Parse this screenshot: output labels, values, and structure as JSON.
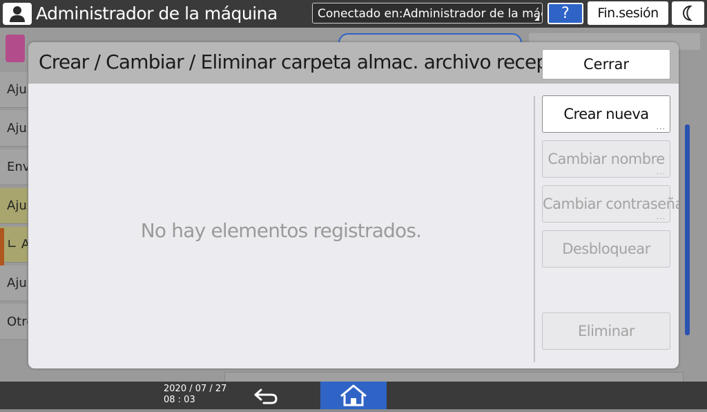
{
  "topbar": {
    "title": "Administrador de la máquina",
    "connection_label": "Conectado en:Administrador de la máquina",
    "help_label": "?",
    "logout_label": "Fin.sesión"
  },
  "sidebar": {
    "items": [
      {
        "label": "Ajus"
      },
      {
        "label": "Ajus"
      },
      {
        "label": "Envi"
      },
      {
        "label": "Ajus"
      },
      {
        "label": "∟ A"
      },
      {
        "label": "Ajus"
      },
      {
        "label": "Otro"
      }
    ]
  },
  "dialog": {
    "title": "Crear / Cambiar / Eliminar carpeta almac. archivo recepción",
    "close_label": "Cerrar",
    "empty_message": "No hay elementos registrados.",
    "actions": [
      {
        "label": "Crear nueva",
        "enabled": true,
        "has_ellipsis": true
      },
      {
        "label": "Cambiar nombre",
        "enabled": false,
        "has_ellipsis": true
      },
      {
        "label": "Cambiar contraseña",
        "enabled": false,
        "has_ellipsis": true
      },
      {
        "label": "Desbloquear",
        "enabled": false,
        "has_ellipsis": false
      },
      {
        "label": "Eliminar",
        "enabled": false,
        "has_ellipsis": false
      }
    ],
    "ellipsis": "..."
  },
  "bottombar": {
    "date": "2020 / 07 / 27",
    "time": "08 : 03"
  },
  "icons": {
    "user": "user-icon",
    "moon": "moon-icon",
    "back": "back-arrow-icon",
    "home": "home-icon",
    "fax": "fax-icon"
  },
  "colors": {
    "accent": "#2f64c6",
    "dialog_bg": "#ececf0",
    "header_bg": "#b7b7b7"
  }
}
